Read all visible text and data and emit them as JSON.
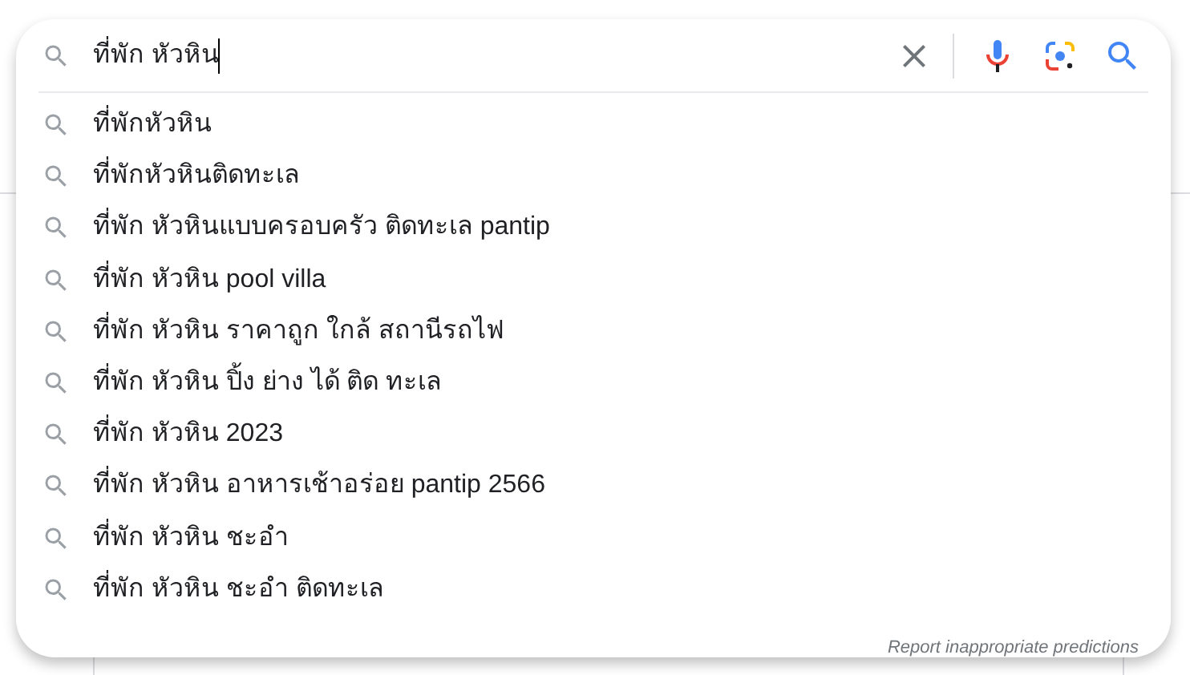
{
  "search": {
    "value": "ที่พัก หัวหิน",
    "focused": true
  },
  "suggestions": [
    {
      "text": "ที่พักหัวหิน"
    },
    {
      "text": "ที่พักหัวหินติดทะเล"
    },
    {
      "text": "ที่พัก หัวหินแบบครอบครัว ติดทะเล pantip"
    },
    {
      "text": "ที่พัก หัวหิน pool villa"
    },
    {
      "text": "ที่พัก หัวหิน ราคาถูก ใกล้ สถานีรถไฟ"
    },
    {
      "text": "ที่พัก หัวหิน ปิ้ง ย่าง ได้ ติด ทะเล"
    },
    {
      "text": "ที่พัก หัวหิน 2023"
    },
    {
      "text": "ที่พัก หัวหิน อาหารเช้าอร่อย pantip 2566"
    },
    {
      "text": "ที่พัก หัวหิน ชะอำ"
    },
    {
      "text": "ที่พัก หัวหิน ชะอำ ติดทะเล"
    }
  ],
  "footer": {
    "link": "Report inappropriate predictions"
  }
}
